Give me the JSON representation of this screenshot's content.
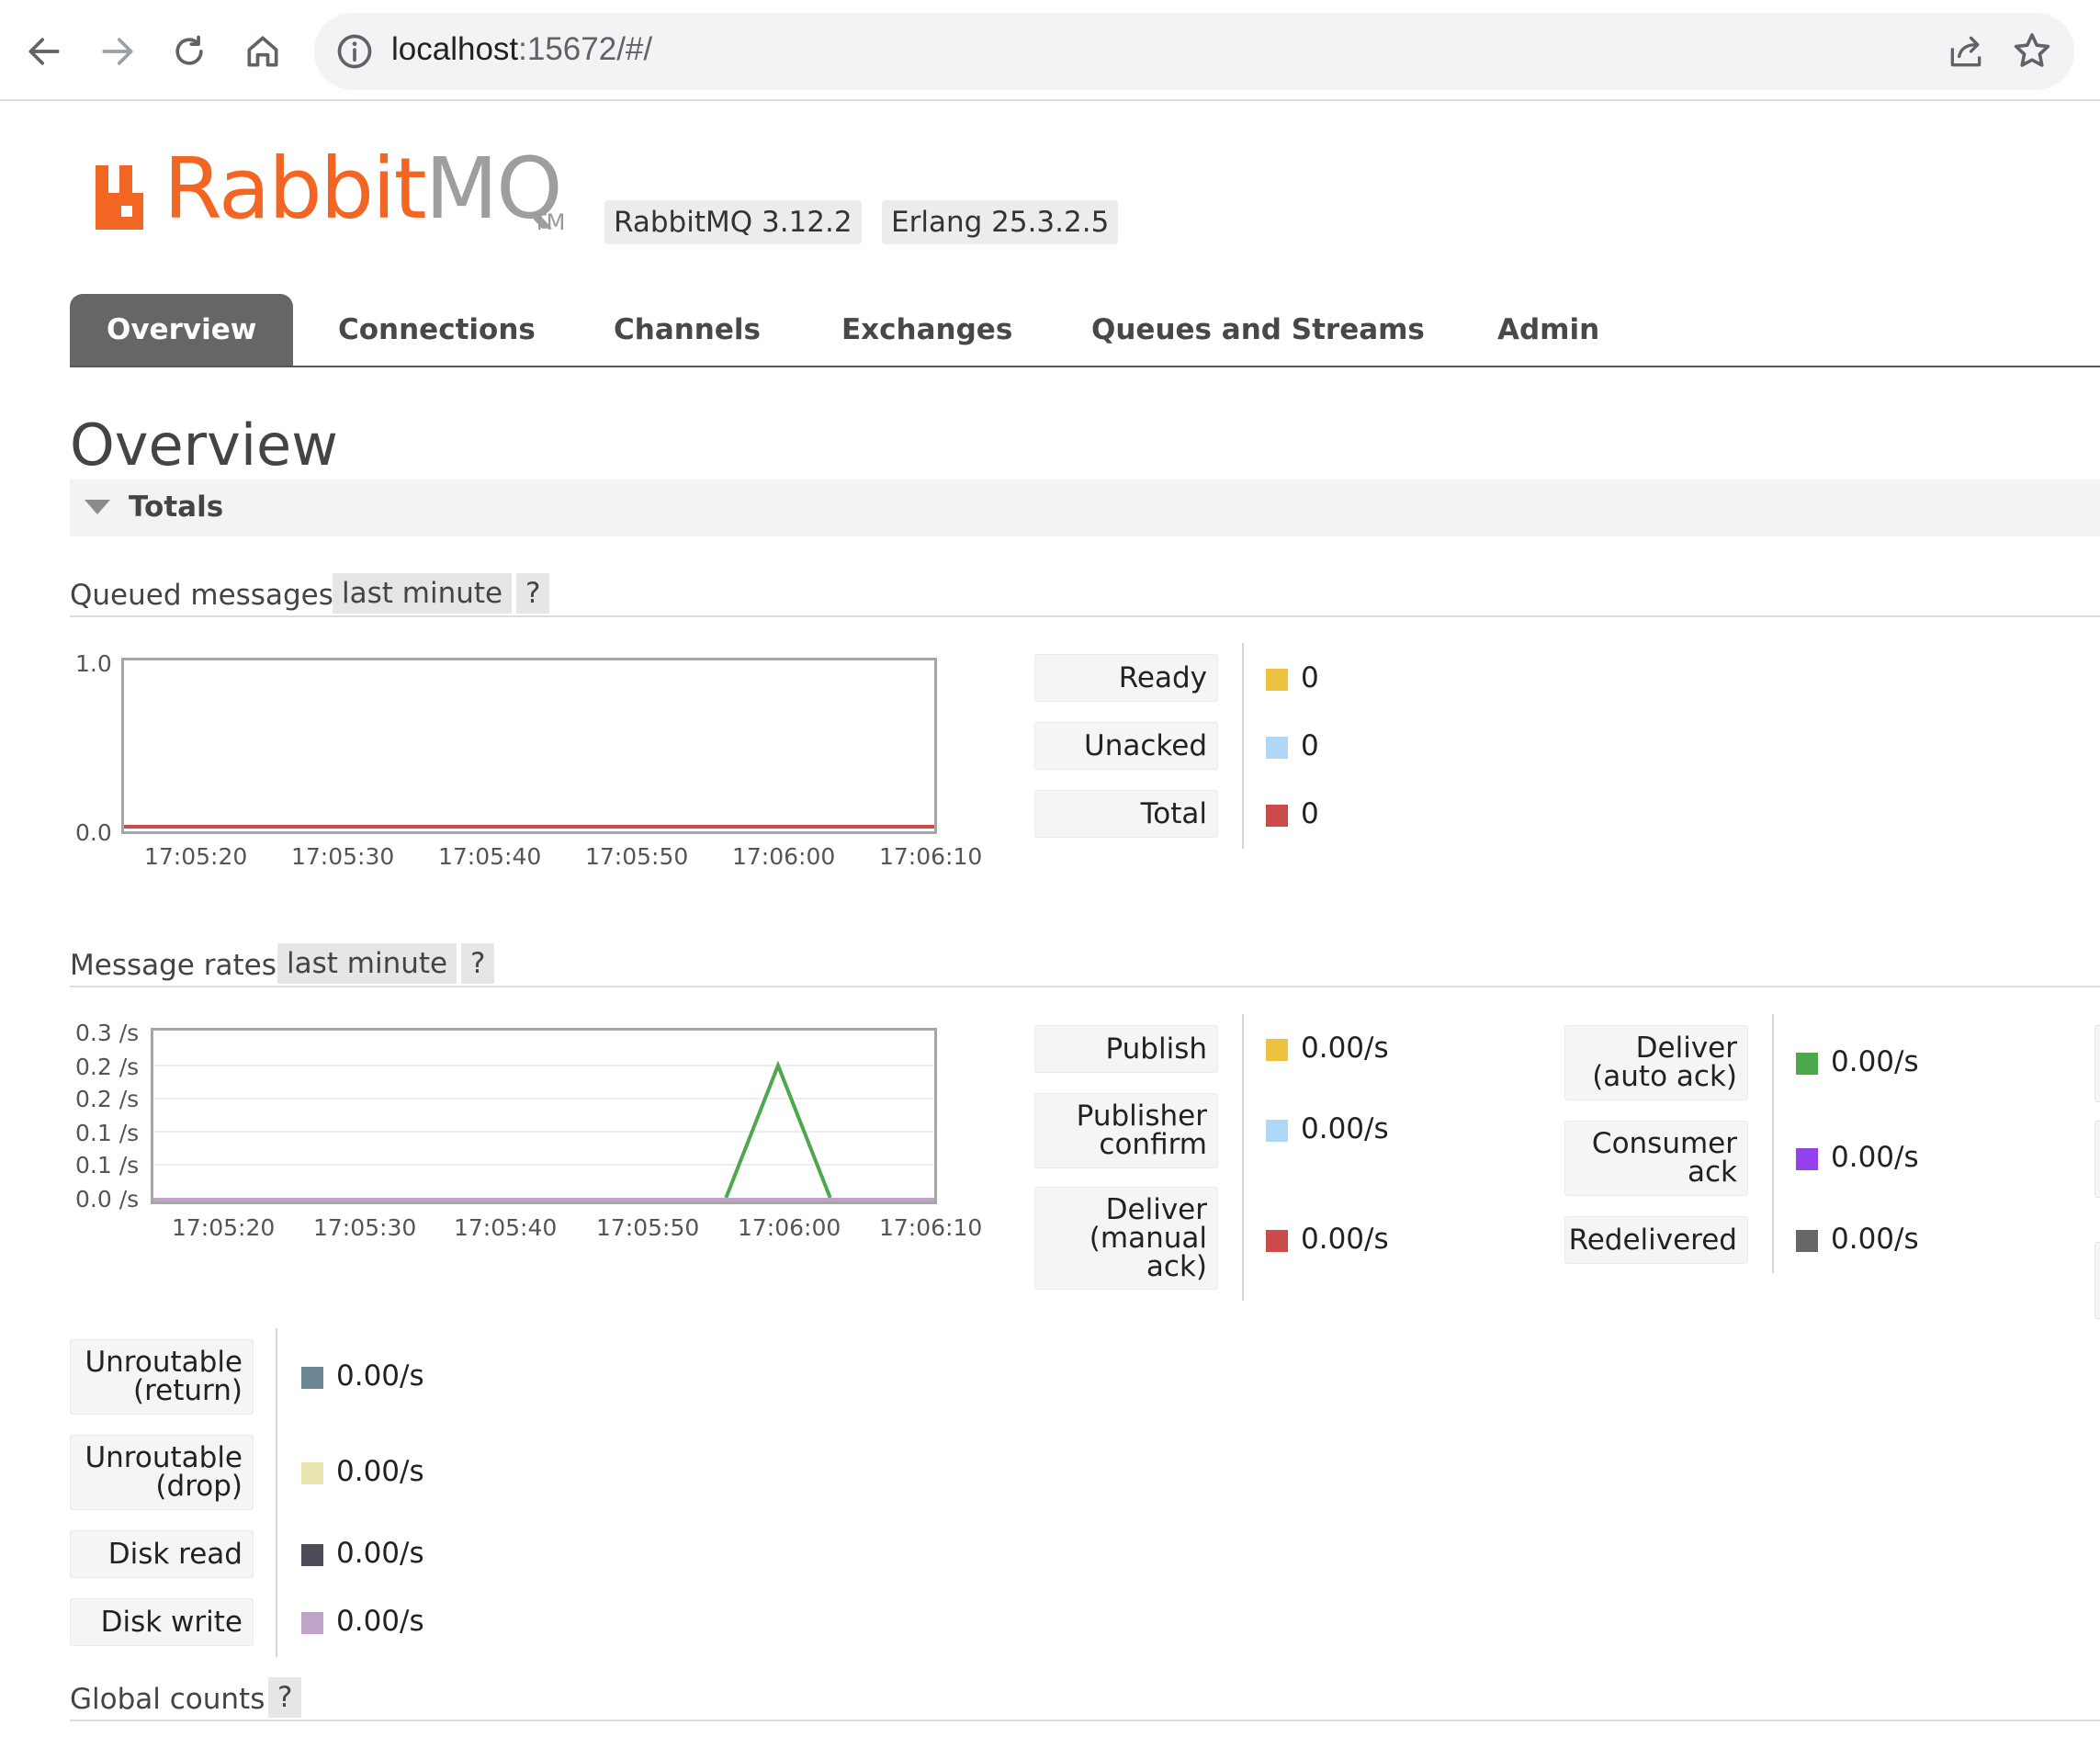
{
  "browser": {
    "url_host": "localhost",
    "url_rest": ":15672/#/"
  },
  "header": {
    "logo_text_primary": "Rabbit",
    "logo_text_secondary": "MQ",
    "logo_tm": "TM",
    "rabbitmq_version": "RabbitMQ 3.12.2",
    "erlang_version": "Erlang 25.3.2.5"
  },
  "tabs": [
    {
      "label": "Overview",
      "active": true
    },
    {
      "label": "Connections",
      "active": false
    },
    {
      "label": "Channels",
      "active": false
    },
    {
      "label": "Exchanges",
      "active": false
    },
    {
      "label": "Queues and Streams",
      "active": false
    },
    {
      "label": "Admin",
      "active": false
    }
  ],
  "page": {
    "title": "Overview",
    "totals_label": "Totals"
  },
  "queued": {
    "title": "Queued messages",
    "range_label": "last minute",
    "help": "?",
    "legend": [
      {
        "label": "Ready",
        "value": "0",
        "color": "#edc240"
      },
      {
        "label": "Unacked",
        "value": "0",
        "color": "#afd8f8"
      },
      {
        "label": "Total",
        "value": "0",
        "color": "#cb4b4b"
      }
    ]
  },
  "rates": {
    "title": "Message rates",
    "range_label": "last minute",
    "help": "?",
    "legend_col1": [
      {
        "label_lines": [
          "Publish"
        ],
        "value": "0.00/s",
        "color": "#edc240"
      },
      {
        "label_lines": [
          "Publisher",
          "confirm"
        ],
        "value": "0.00/s",
        "color": "#afd8f8"
      },
      {
        "label_lines": [
          "Deliver",
          "(manual",
          "ack)"
        ],
        "value": "0.00/s",
        "color": "#cb4b4b"
      }
    ],
    "legend_col2": [
      {
        "label_lines": [
          "Deliver",
          "(auto ack)"
        ],
        "value": "0.00/s",
        "color": "#4da74d"
      },
      {
        "label_lines": [
          "Consumer",
          "ack"
        ],
        "value": "0.00/s",
        "color": "#9440ed"
      },
      {
        "label_lines": [
          "Redelivered"
        ],
        "value": "0.00/s",
        "color": "#666666"
      }
    ],
    "legend_col3": [
      {
        "label_lines": [
          "Unroutable",
          "(return)"
        ],
        "value": "0.00/s",
        "color": "#6c8794"
      },
      {
        "label_lines": [
          "Unroutable",
          "(drop)"
        ],
        "value": "0.00/s",
        "color": "#e8e4b0"
      },
      {
        "label_lines": [
          "Disk read"
        ],
        "value": "0.00/s",
        "color": "#4c4c59"
      },
      {
        "label_lines": [
          "Disk write"
        ],
        "value": "0.00/s",
        "color": "#c0a3c8"
      }
    ]
  },
  "global": {
    "title": "Global counts",
    "help": "?"
  },
  "chart_data": [
    {
      "type": "line",
      "title": "Queued messages",
      "x": [
        "17:05:20",
        "17:05:30",
        "17:05:40",
        "17:05:50",
        "17:06:00",
        "17:06:10"
      ],
      "y_ticks": [
        "1.0",
        "0.0"
      ],
      "ylim": [
        0,
        1
      ],
      "series": [
        {
          "name": "Ready",
          "values": [
            0,
            0,
            0,
            0,
            0,
            0
          ]
        },
        {
          "name": "Unacked",
          "values": [
            0,
            0,
            0,
            0,
            0,
            0
          ]
        },
        {
          "name": "Total",
          "values": [
            0,
            0,
            0,
            0,
            0,
            0
          ]
        }
      ]
    },
    {
      "type": "line",
      "title": "Message rates",
      "x": [
        "17:05:20",
        "17:05:30",
        "17:05:40",
        "17:05:50",
        "17:06:00",
        "17:06:10"
      ],
      "y_ticks": [
        "0.3 /s",
        "0.2 /s",
        "0.2 /s",
        "0.1 /s",
        "0.1 /s",
        "0.0 /s"
      ],
      "ylim": [
        0,
        0.25
      ],
      "series": [
        {
          "name": "Deliver (auto ack)",
          "points": [
            [
              55,
              0
            ],
            [
              60,
              0.2
            ],
            [
              65,
              0
            ]
          ]
        },
        {
          "name": "Disk write",
          "points": [
            [
              15,
              0
            ],
            [
              70,
              0
            ]
          ]
        }
      ]
    }
  ]
}
